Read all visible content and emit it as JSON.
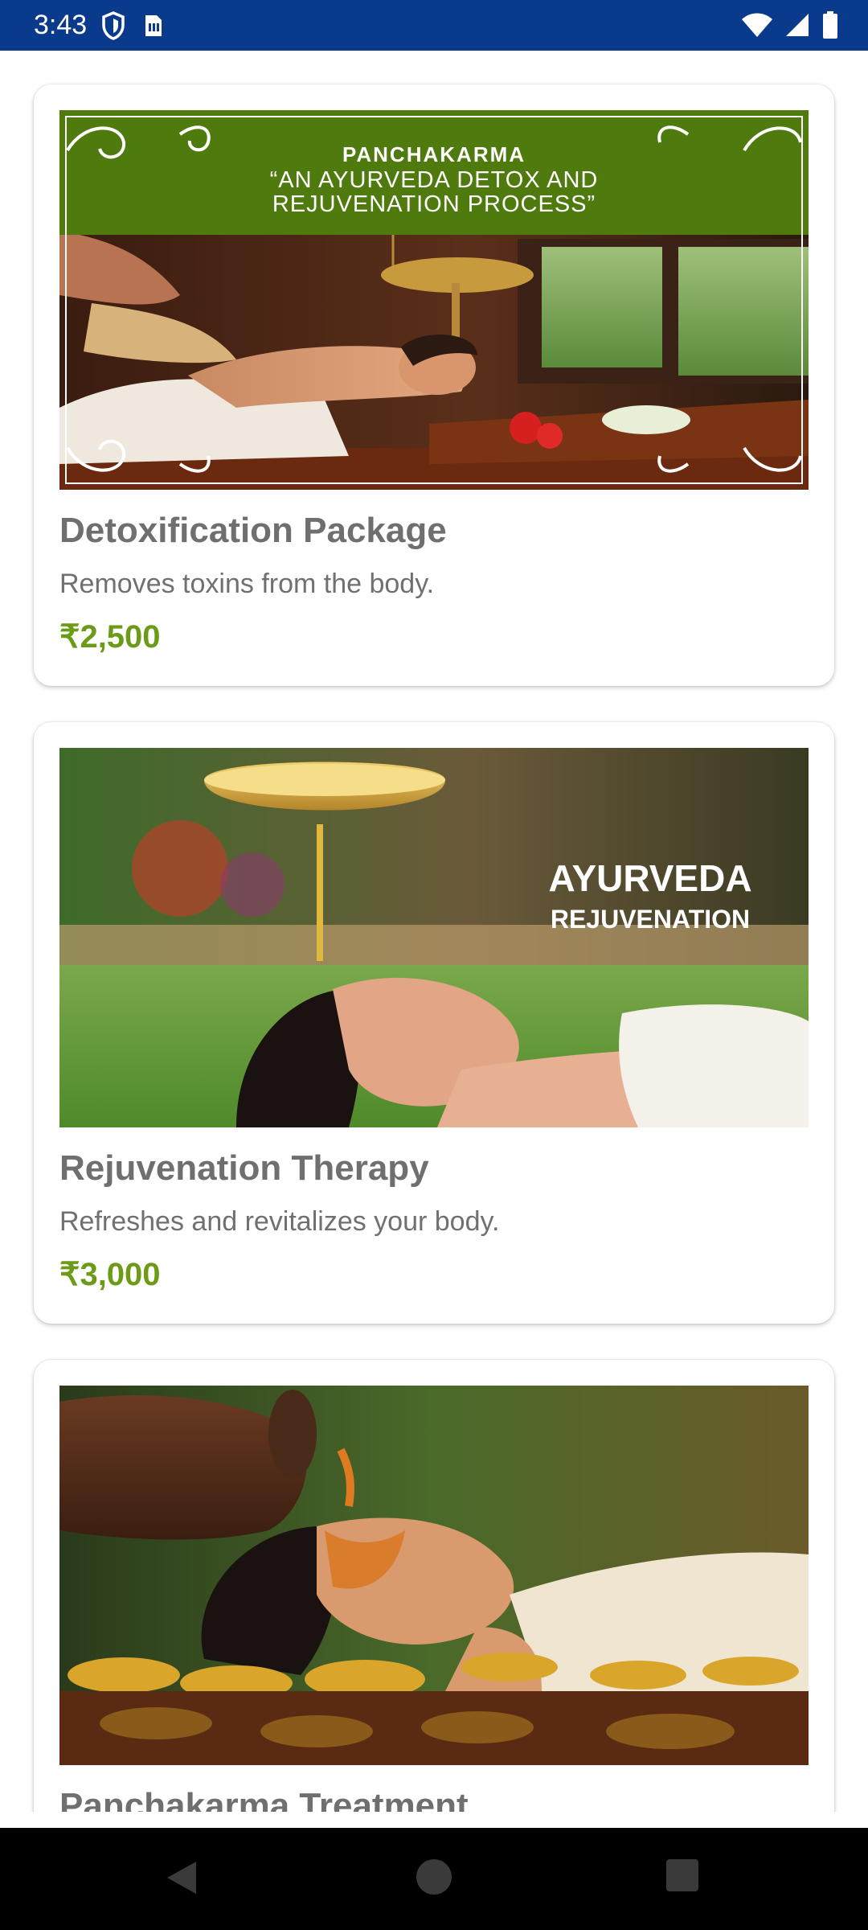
{
  "status_bar": {
    "time": "3:43",
    "left_icons": [
      "shield-icon",
      "sim-card-icon"
    ],
    "right_icons": [
      "wifi-icon",
      "cell-signal-icon",
      "battery-icon"
    ]
  },
  "colors": {
    "status_bar": "#0a3a8c",
    "price": "#6b9b17",
    "title": "#6f6f6f",
    "banner_green": "#4f7a0e"
  },
  "packages": [
    {
      "image_text": {
        "line1": "PANCHAKARMA",
        "line2": "“AN AYURVEDA DETOX AND",
        "line3": "REJUVENATION PROCESS”"
      },
      "title": "Detoxification Package",
      "description": "Removes toxins from the body.",
      "price": "₹2,500"
    },
    {
      "image_text": {
        "line1": "AYURVEDA",
        "line2": "REJUVENATION"
      },
      "title": "Rejuvenation Therapy",
      "description": "Refreshes and revitalizes your body.",
      "price": "₹3,000"
    },
    {
      "title": "Panchakarma Treatment"
    }
  ],
  "nav_bar": {
    "buttons": [
      "back-icon",
      "home-icon",
      "recents-icon"
    ]
  }
}
